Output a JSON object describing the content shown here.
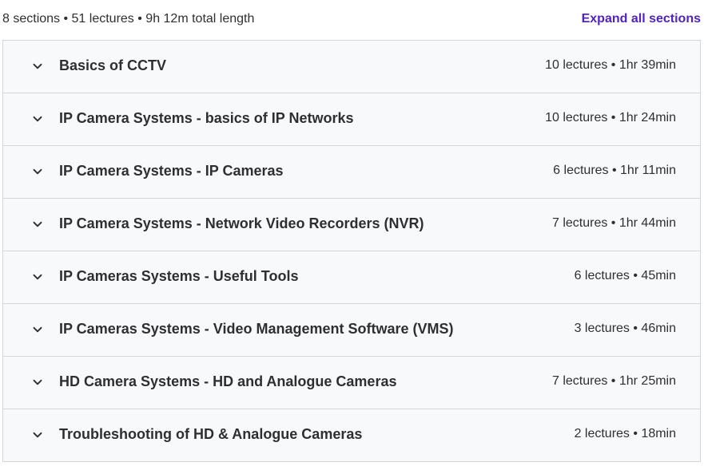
{
  "summary": {
    "text": "8 sections • 51 lectures • 9h 12m total length",
    "expand_all_label": "Expand all sections"
  },
  "sections": [
    {
      "title": "Basics of CCTV",
      "meta": "10 lectures • 1hr 39min"
    },
    {
      "title": "IP Camera Systems - basics of IP Networks",
      "meta": "10 lectures • 1hr 24min"
    },
    {
      "title": "IP Camera Systems - IP Cameras",
      "meta": "6 lectures • 1hr 11min"
    },
    {
      "title": "IP Camera Systems - Network Video Recorders (NVR)",
      "meta": "7 lectures • 1hr 44min"
    },
    {
      "title": "IP Cameras Systems - Useful Tools",
      "meta": "6 lectures • 45min"
    },
    {
      "title": "IP Cameras Systems - Video Management Software (VMS)",
      "meta": "3 lectures • 46min"
    },
    {
      "title": "HD Camera Systems - HD and Analogue Cameras",
      "meta": "7 lectures • 1hr 25min"
    },
    {
      "title": "Troubleshooting of HD & Analogue Cameras",
      "meta": "2 lectures • 18min"
    }
  ],
  "colors": {
    "accent": "#5022c3",
    "row_background": "#f7f9fa",
    "border": "#d1d7dc",
    "text": "#2d2f31"
  },
  "icons": {
    "section_toggle": "chevron-down-icon"
  }
}
